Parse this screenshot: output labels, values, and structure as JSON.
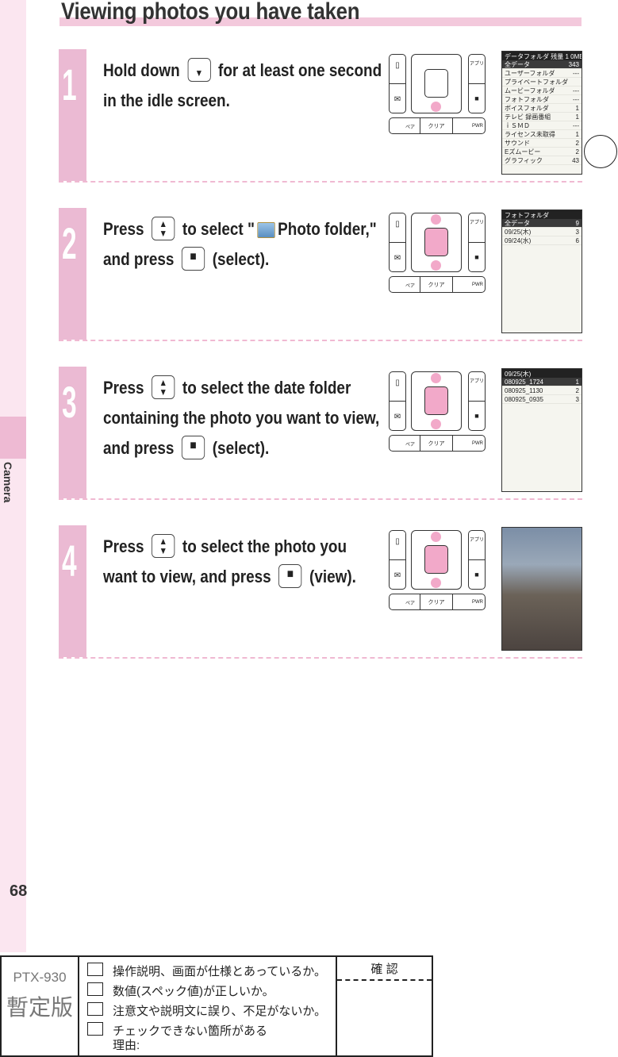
{
  "title": "Viewing photos you have taken",
  "side_label": "Camera",
  "page_number": "68",
  "accent": "#ebbad3",
  "steps": [
    {
      "num": "1",
      "parts": [
        "Hold down",
        "for at least one second in the idle screen."
      ],
      "keys": [
        "down"
      ],
      "screen": {
        "header": "データフォルダ 残量 1 0MB",
        "rows": [
          [
            "全データ",
            "343"
          ],
          [
            "ユーザーフォルダ",
            "---"
          ],
          [
            "プライベートフォルダ",
            ""
          ],
          [
            "ムービーフォルダ",
            "---"
          ],
          [
            "フォトフォルダ",
            "---"
          ],
          [
            "ボイスフォルダ",
            "1"
          ],
          [
            "テレビ 録画番組",
            "1"
          ],
          [
            "ｉＳＭＤ",
            "---"
          ],
          [
            "ライセンス未取得",
            "1"
          ],
          [
            "サウンド",
            "2"
          ],
          [
            "Eズムービー",
            "2"
          ],
          [
            "グラフィック",
            "43"
          ]
        ]
      }
    },
    {
      "num": "2",
      "parts": [
        "Press",
        "to select \"",
        "Photo folder,\" and press",
        "(select)."
      ],
      "keys": [
        "updown",
        "select"
      ],
      "screen": {
        "header": "フォトフォルダ",
        "rows": [
          [
            "全データ",
            "9"
          ],
          [
            "09/25(木)",
            "3"
          ],
          [
            "09/24(水)",
            "6"
          ]
        ]
      }
    },
    {
      "num": "3",
      "parts": [
        "Press",
        "to select the date folder containing the photo you want to view, and press",
        "(select)."
      ],
      "keys": [
        "updown",
        "select"
      ],
      "screen": {
        "header": "09/25(木)",
        "rows": [
          [
            "080925_1724",
            "1"
          ],
          [
            "080925_1130",
            "2"
          ],
          [
            "080925_0935",
            "3"
          ]
        ]
      }
    },
    {
      "num": "4",
      "parts": [
        "Press",
        "to select the photo you want to view, and press",
        "(view)."
      ],
      "keys": [
        "updown",
        "select"
      ],
      "screen": {
        "photo": true
      }
    }
  ],
  "keypad": {
    "book": "🕮",
    "mail": "✉",
    "appli": "アプリ",
    "pair": "ペア",
    "clear": "クリア",
    "pwr": "PWR"
  },
  "stamp": {
    "model": "PTX-930",
    "version": "暫定版",
    "confirm": "確 認",
    "items": [
      "操作説明、画面が仕様とあっているか。",
      "数値(スペック値)が正しいか。",
      "注意文や説明文に誤り、不足がないか。",
      "チェックできない箇所がある"
    ],
    "reason": "理由:"
  }
}
